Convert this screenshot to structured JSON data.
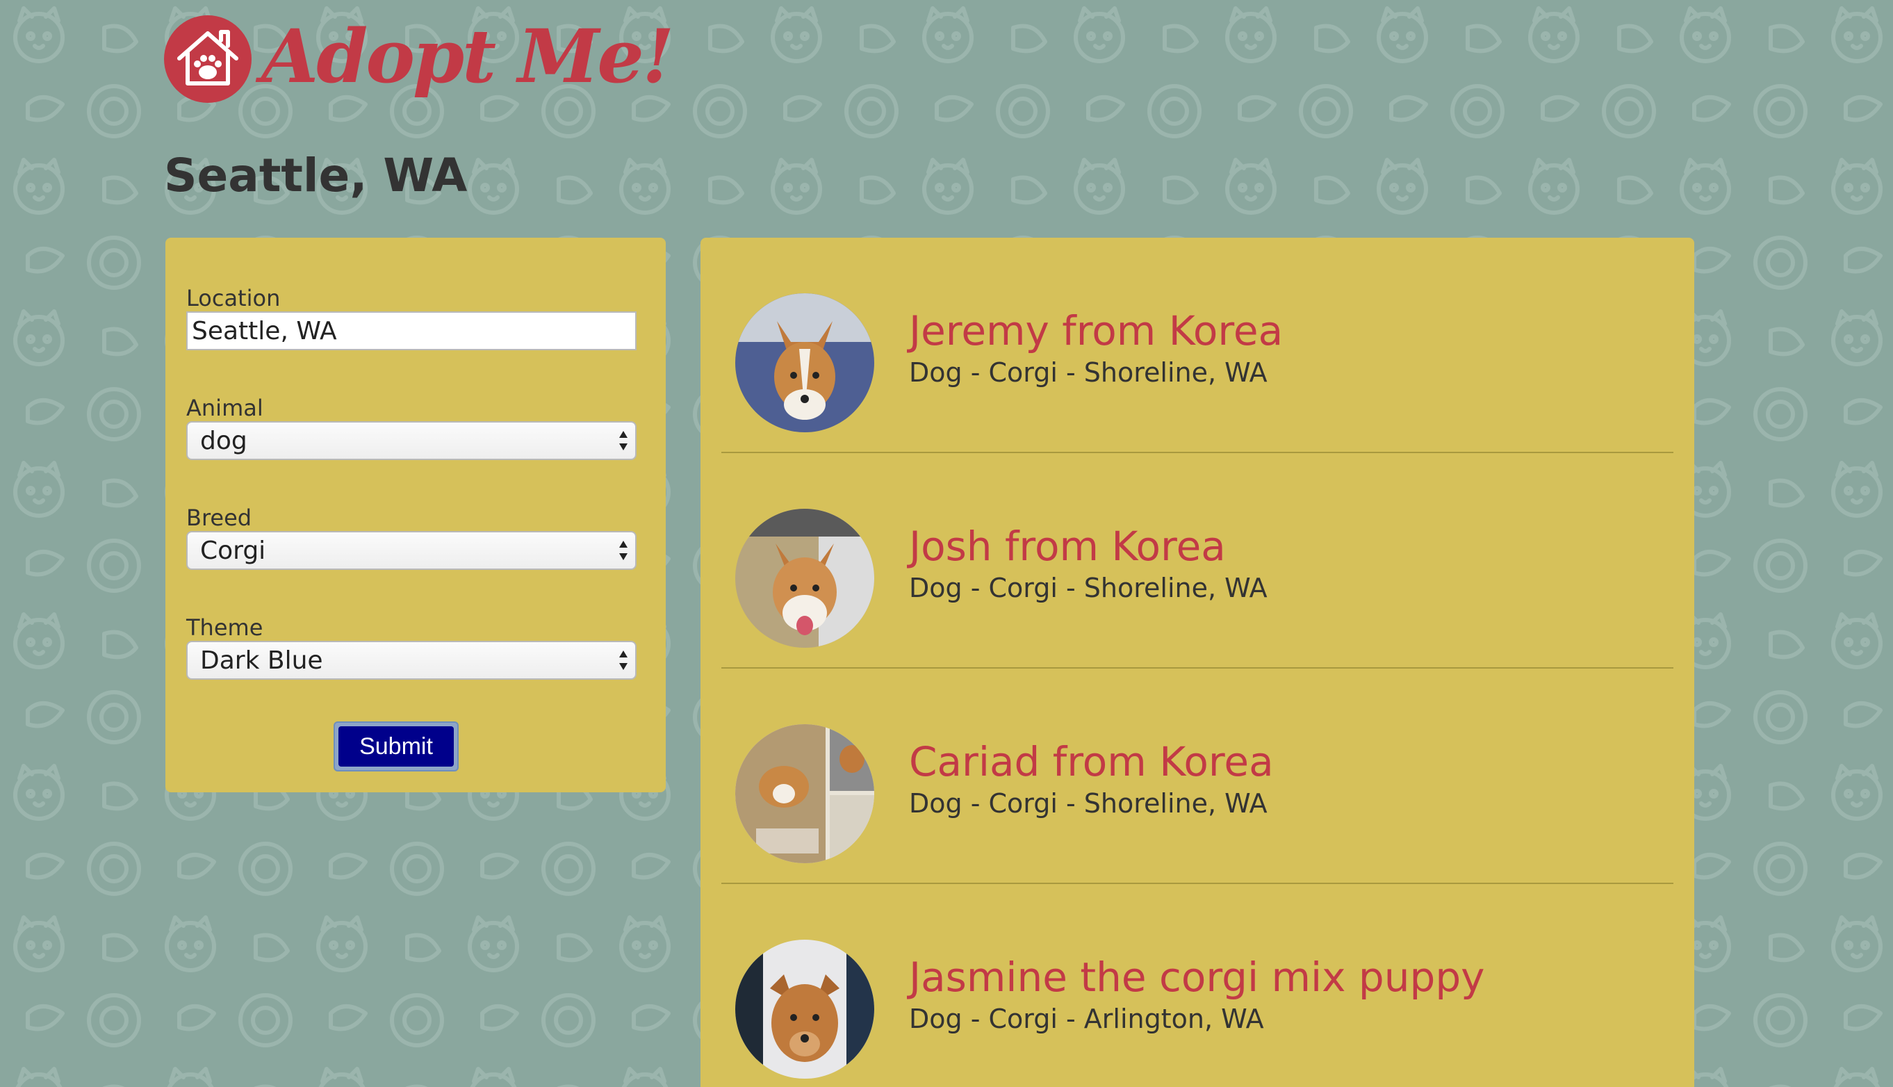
{
  "header": {
    "logo_text": "Adopt Me!",
    "logo_icon": "house-paw-icon"
  },
  "page": {
    "location_heading": "Seattle, WA"
  },
  "search_form": {
    "location_label": "Location",
    "location_value": "Seattle, WA",
    "animal_label": "Animal",
    "animal_value": "dog",
    "breed_label": "Breed",
    "breed_value": "Corgi",
    "theme_label": "Theme",
    "theme_value": "Dark Blue",
    "submit_label": "Submit"
  },
  "results": [
    {
      "name": "Jeremy from Korea",
      "info": "Dog - Corgi - Shoreline, WA",
      "photo": "corgi-photo"
    },
    {
      "name": "Josh from Korea",
      "info": "Dog - Corgi - Shoreline, WA",
      "photo": "corgi-photo"
    },
    {
      "name": "Cariad from Korea",
      "info": "Dog - Corgi - Shoreline, WA",
      "photo": "corgi-collage-photo"
    },
    {
      "name": "Jasmine the corgi mix puppy",
      "info": "Dog - Corgi - Arlington, WA",
      "photo": "puppy-photo"
    }
  ],
  "colors": {
    "background": "#8aa79e",
    "panel": "#d6c15a",
    "brand_red": "#c23a46",
    "submit_blue": "#00008b"
  }
}
